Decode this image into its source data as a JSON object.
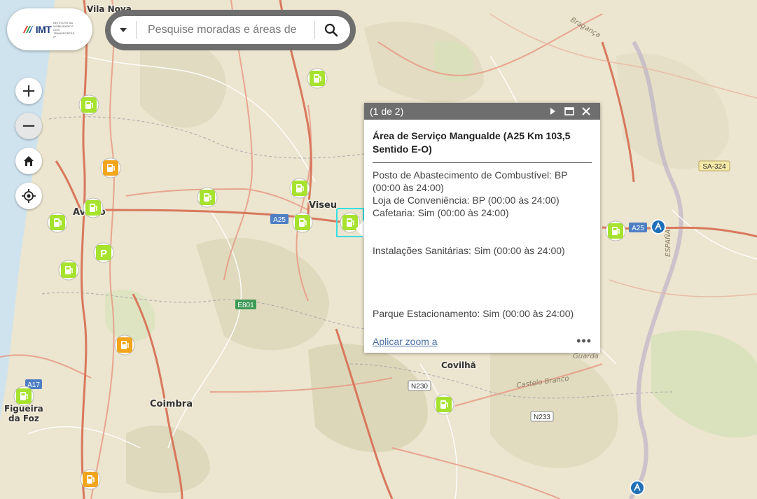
{
  "logo": {
    "text": "IMT",
    "subtitle": "INSTITUTO DA MOBILIDADE E DOS TRANSPORTES, IP"
  },
  "search": {
    "placeholder": "Pesquise moradas e áreas de"
  },
  "controls": {
    "zoom_in": "+",
    "zoom_out": "−"
  },
  "popup": {
    "count": "(1 de 2)",
    "title": "Área de Serviço Mangualde (A25 Km 103,5 Sentido E-O)",
    "lines": [
      "Posto de Abastecimento de Combustível: BP (00:00 às 24:00)",
      "Loja de Conveniência: BP (00:00 às 24:00)",
      "Cafetaria: Sim (00:00 às 24:00)",
      "Instalações Sanitárias: Sim (00:00 às 24:00)",
      "Parque Estacionamento: Sim (00:00 às 24:00)"
    ],
    "zoom_link": "Aplicar zoom a",
    "more": "•••"
  },
  "map": {
    "places": {
      "vila_nova": "Vila Nova",
      "viseu": "Viseu",
      "aveiro": "Aveiro",
      "coimbra": "Coimbra",
      "figueira": "Figueira",
      "da_foz": "da Foz",
      "covilha": "Covilhã"
    },
    "labels": {
      "espana": "ESPAÑA",
      "castelo_branco": "Castelo Branco",
      "guarda": "Guarda",
      "braganca": "Bragança"
    },
    "shields": {
      "a25_west": "A25",
      "a25_east": "A25",
      "e801": "E801",
      "a17": "A17",
      "n230": "N230",
      "n233": "N233",
      "sa324": "SA-324"
    },
    "markers": {
      "fuel_green": "fuel-green",
      "fuel_orange": "fuel-orange",
      "parking": "P",
      "highway_service": "highway-service"
    }
  },
  "colors": {
    "fuel_green": "#a6e22e",
    "fuel_orange": "#f2a51a",
    "popup_header": "#6e6e6e",
    "link": "#4a6fa5",
    "selection": "#35e0e0",
    "sea": "#cfe3ef"
  }
}
